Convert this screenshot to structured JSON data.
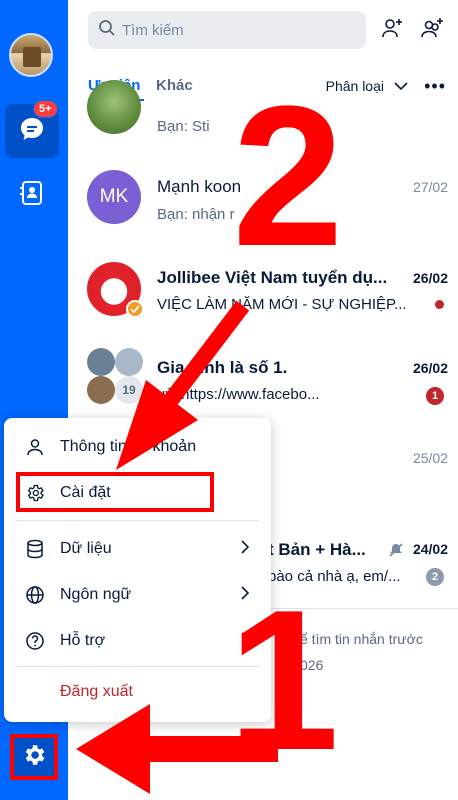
{
  "search": {
    "placeholder": "Tìm kiếm"
  },
  "tabs": {
    "priority": "Ưu tiên",
    "other": "Khác",
    "sort": "Phân loại"
  },
  "nav": {
    "badge": "5+"
  },
  "conversations": [
    {
      "name": "",
      "preview": "Bạn: Sti"
    },
    {
      "initials": "MK",
      "name": "Mạnh koon",
      "preview": "Bạn: nhận r",
      "time": "27/02"
    },
    {
      "name": "Jollibee Việt Nam tuyển dụ...",
      "preview": "VIỆC LÀM NĂM MỚI - SỰ NGHIỆP...",
      "time": "26/02",
      "group_count": ""
    },
    {
      "name": "Gia đình là số 1.",
      "preview": "uỷ: https://www.facebo...",
      "time": "26/02",
      "unread": "1",
      "member_count": "19"
    },
    {
      "name": "",
      "preview": "",
      "time": "25/02"
    },
    {
      "name": "t Bản + Hà...",
      "preview": "bào cả nhà ạ, em/...",
      "time": "24/02",
      "unread": "2"
    }
  ],
  "footer_note": {
    "line1": "ể tìm tin nhắn trước",
    "line2": "026"
  },
  "menu": {
    "items": [
      {
        "label": "Thông tin tài khoản"
      },
      {
        "label": "Cài đặt"
      },
      {
        "label": "Dữ liệu"
      },
      {
        "label": "Ngôn ngữ"
      },
      {
        "label": "Hỗ trợ"
      }
    ],
    "logout": "Đăng xuất"
  },
  "annotations": {
    "step_top": "2",
    "step_bottom": "1"
  },
  "colors": {
    "brand": "#0068ff",
    "annotation": "#ff0000"
  }
}
